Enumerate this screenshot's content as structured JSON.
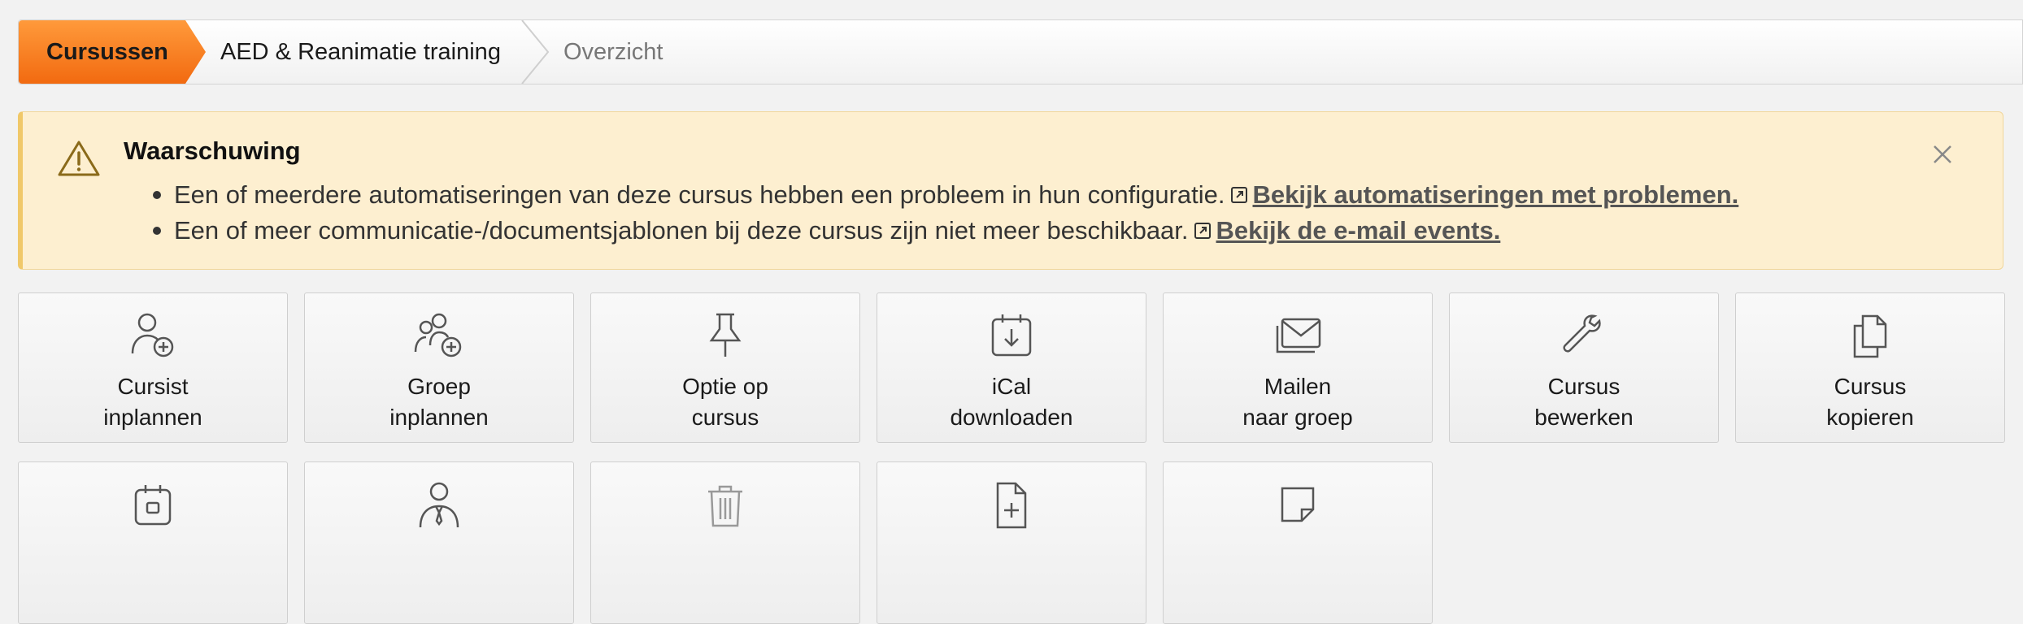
{
  "breadcrumb": {
    "items": [
      "Cursussen",
      "AED & Reanimatie training",
      "Overzicht"
    ]
  },
  "alert": {
    "title": "Waarschuwing",
    "messages": [
      {
        "text": "Een of meerdere automatiseringen van deze cursus hebben een probleem in hun configuratie.",
        "link": "Bekijk automatiseringen met problemen."
      },
      {
        "text": "Een of meer communicatie-/documentsjablonen bij deze cursus zijn niet meer beschikbaar.",
        "link": "Bekijk de e-mail events."
      }
    ],
    "colors": {
      "background": "#fdefd0",
      "border": "#f0c869"
    }
  },
  "actions": [
    {
      "line1": "Cursist",
      "line2": "inplannen",
      "icon": "user-plus-icon"
    },
    {
      "line1": "Groep",
      "line2": "inplannen",
      "icon": "group-plus-icon"
    },
    {
      "line1": "Optie op",
      "line2": "cursus",
      "icon": "pin-icon"
    },
    {
      "line1": "iCal",
      "line2": "downloaden",
      "icon": "calendar-download-icon"
    },
    {
      "line1": "Mailen",
      "line2": "naar groep",
      "icon": "mail-stack-icon"
    },
    {
      "line1": "Cursus",
      "line2": "bewerken",
      "icon": "wrench-icon"
    },
    {
      "line1": "Cursus",
      "line2": "kopieren",
      "icon": "copy-icon"
    },
    {
      "line1": "",
      "line2": "",
      "icon": "calendar-icon"
    },
    {
      "line1": "",
      "line2": "",
      "icon": "user-tie-icon"
    },
    {
      "line1": "",
      "line2": "",
      "icon": "trash-icon"
    },
    {
      "line1": "",
      "line2": "",
      "icon": "file-plus-icon"
    },
    {
      "line1": "",
      "line2": "",
      "icon": "sticky-note-icon"
    }
  ],
  "colors": {
    "accent": "#f57e20"
  }
}
